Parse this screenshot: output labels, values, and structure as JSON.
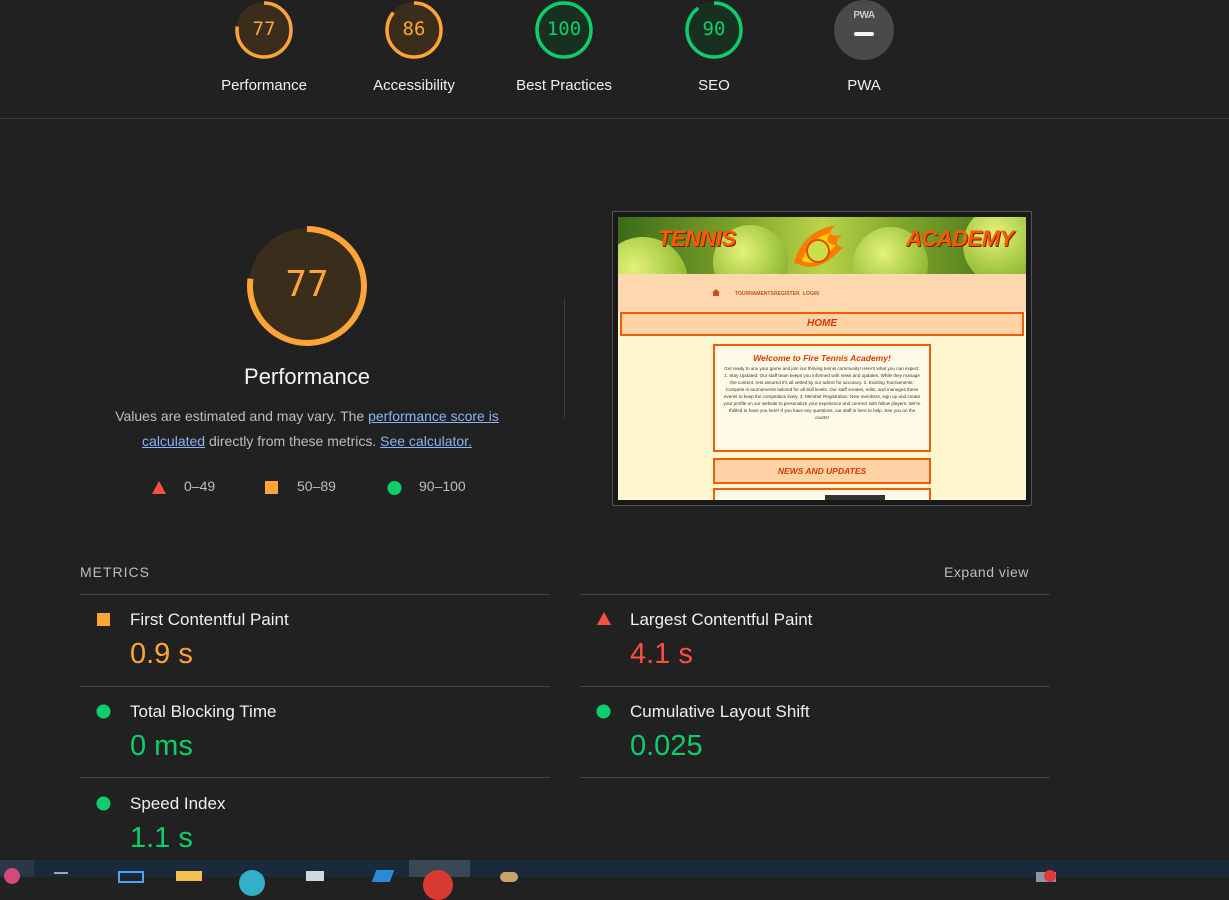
{
  "scores": [
    {
      "label": "Performance",
      "value": 77,
      "color": "#ffa436"
    },
    {
      "label": "Accessibility",
      "value": 86,
      "color": "#ffa436"
    },
    {
      "label": "Best Practices",
      "value": 100,
      "color": "#0cce6b"
    },
    {
      "label": "SEO",
      "value": 90,
      "color": "#0cce6b"
    },
    {
      "label": "PWA",
      "badge": "PWA"
    }
  ],
  "performance": {
    "score": 77,
    "title": "Performance",
    "desc_prefix": "Values are estimated and may vary. The ",
    "link_score": "performance score is calculated",
    "desc_mid": " directly from these metrics. ",
    "link_calc": "See calculator.",
    "legend": [
      {
        "range": "0–49",
        "shape": "triangle",
        "color": "#ff4e42"
      },
      {
        "range": "50–89",
        "shape": "square",
        "color": "#ffa436"
      },
      {
        "range": "90–100",
        "shape": "circle",
        "color": "#0cce6b"
      }
    ]
  },
  "screenshot": {
    "brand_left": "TENNIS",
    "brand_right": "ACADEMY",
    "nav": [
      "TOURNAMENTS",
      "REGISTER",
      "LOGIN"
    ],
    "home": "HOME",
    "welcome_title": "Welcome to Fire Tennis Academy!",
    "welcome_body": "Get ready to ace your game and join our thriving tennis community! Here's what you can expect: 1. Stay Updated: Our staff team keeps you informed with news and updates. While they manage the content, rest assured it's all vetted by our admin for accuracy. 2. Exciting Tournaments: Compete in tournaments tailored for all skill levels. Our staff creates, edits, and manages these events to keep the competition lively. 3. Member Registration: New members, sign up and create your profile on our website to personalize your experience and connect with fellow players. We're thrilled to have you here! If you have any questions, our staff is here to help. See you on the courts!",
    "news": "NEWS AND UPDATES"
  },
  "metrics": {
    "heading": "METRICS",
    "expand": "Expand view",
    "items": [
      {
        "name": "First Contentful Paint",
        "value": "0.9 s",
        "status": "average",
        "shape": "square",
        "color": "#ffa436"
      },
      {
        "name": "Largest Contentful Paint",
        "value": "4.1 s",
        "status": "fail",
        "shape": "triangle",
        "color": "#ff4e42"
      },
      {
        "name": "Total Blocking Time",
        "value": "0 ms",
        "status": "pass",
        "shape": "circle",
        "color": "#0cce6b"
      },
      {
        "name": "Cumulative Layout Shift",
        "value": "0.025",
        "status": "pass",
        "shape": "circle",
        "color": "#0cce6b"
      },
      {
        "name": "Speed Index",
        "value": "1.1 s",
        "status": "pass",
        "shape": "circle",
        "color": "#0cce6b"
      }
    ]
  },
  "taskbar": {
    "icons": [
      "app-icon",
      "search-icon",
      "task-view-icon",
      "folder-icon",
      "edge-icon",
      "file-icon",
      "vscode-icon",
      "chrome-icon",
      "paint-icon",
      "notification-icon"
    ]
  }
}
